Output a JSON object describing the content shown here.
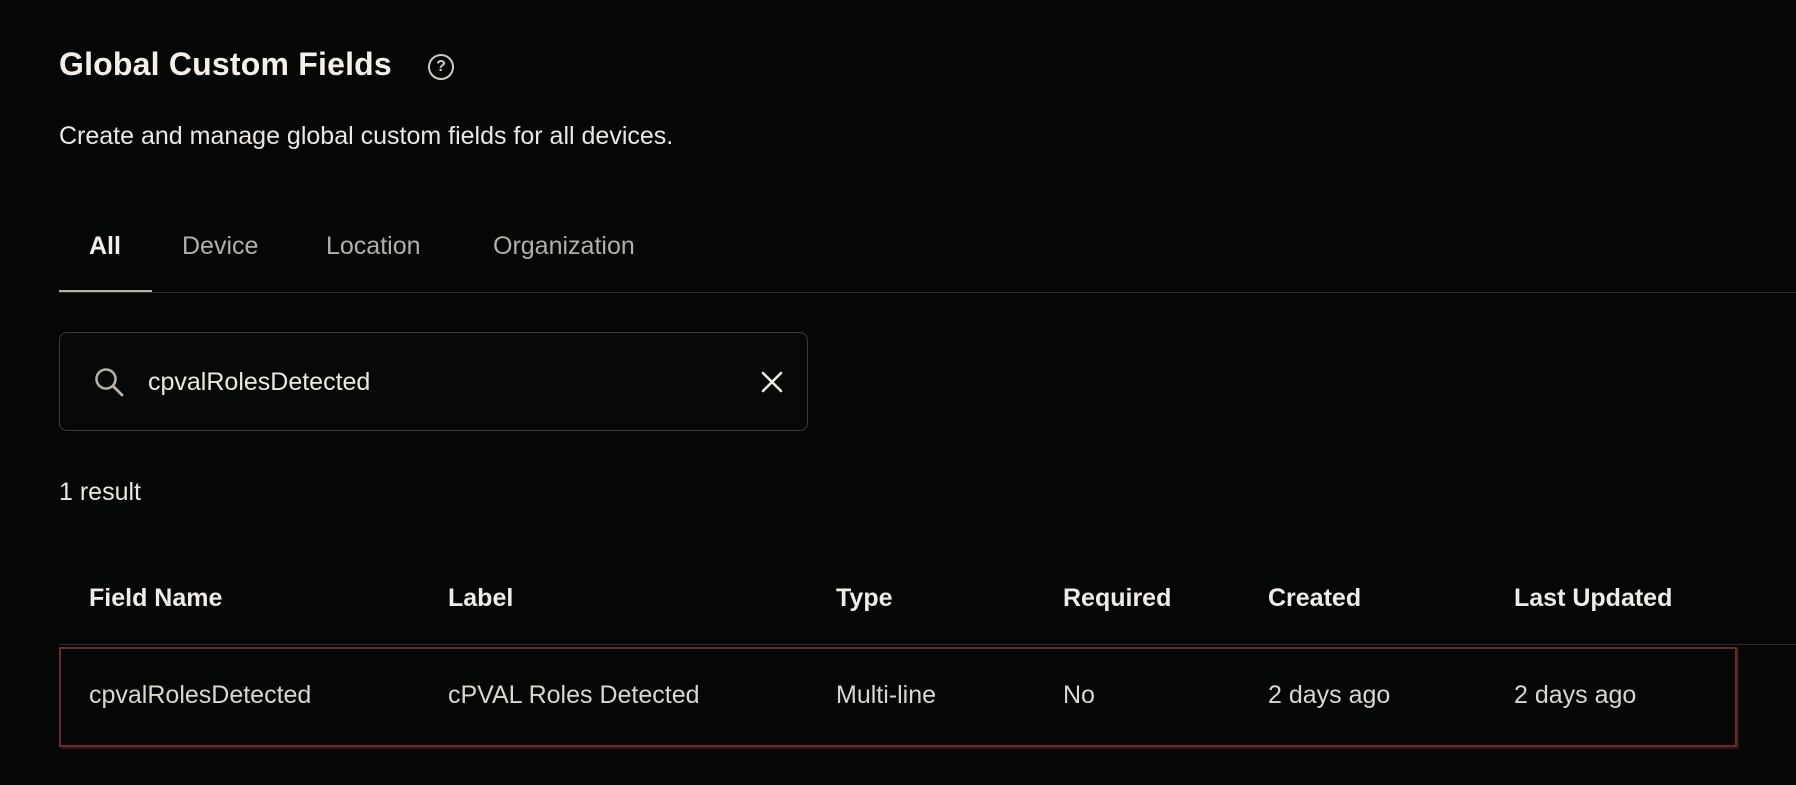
{
  "header": {
    "title": "Global Custom Fields",
    "help_icon": "question-circle-icon",
    "help_glyph": "?",
    "subtitle": "Create and manage global custom fields for all devices."
  },
  "tabs": [
    {
      "label": "All",
      "active": true
    },
    {
      "label": "Device",
      "active": false
    },
    {
      "label": "Location",
      "active": false
    },
    {
      "label": "Organization",
      "active": false
    }
  ],
  "search": {
    "value": "cpvalRolesDetected",
    "placeholder": "",
    "icon": "search-icon",
    "clear_icon": "close-icon"
  },
  "results": {
    "count_text": "1 result"
  },
  "table": {
    "columns": [
      "Field Name",
      "Label",
      "Type",
      "Required",
      "Created",
      "Last Updated"
    ],
    "rows": [
      [
        "cpvalRolesDetected",
        "cPVAL Roles Detected",
        "Multi-line",
        "No",
        "2 days ago",
        "2 days ago"
      ]
    ]
  },
  "colors": {
    "background": "#050606",
    "text": "#f1ece6",
    "muted_text": "#b6afa7",
    "row_highlight_border": "#6b2a2c"
  }
}
